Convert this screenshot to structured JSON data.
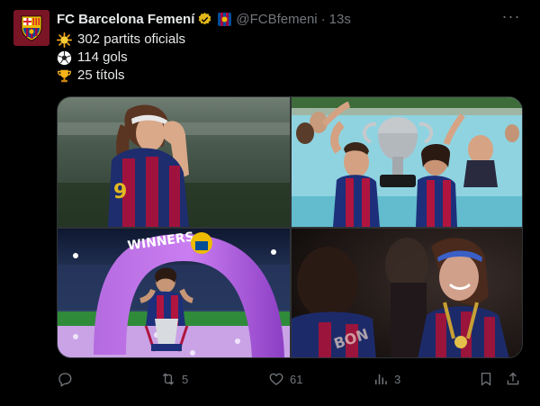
{
  "account": {
    "name": "FC Barcelona Femení",
    "handle": "@FCBfemeni",
    "time": "13s"
  },
  "tweet": {
    "lines": [
      {
        "emoji": "sun-emoji",
        "text": "302 partits oficials"
      },
      {
        "emoji": "soccer-ball-emoji",
        "text": "114 gols"
      },
      {
        "emoji": "trophy-emoji",
        "text": "25 títols"
      }
    ]
  },
  "media": {
    "photo3_banner_text": "WINNERS"
  },
  "actions": {
    "replies": "",
    "retweets": "5",
    "likes": "61",
    "views": "3"
  },
  "colors": {
    "background": "#000000",
    "text": "#e7e9ea",
    "muted": "#71767b",
    "verified_gold": "#e2b719",
    "barca_blue": "#004d98",
    "barca_garnet": "#a50044"
  }
}
